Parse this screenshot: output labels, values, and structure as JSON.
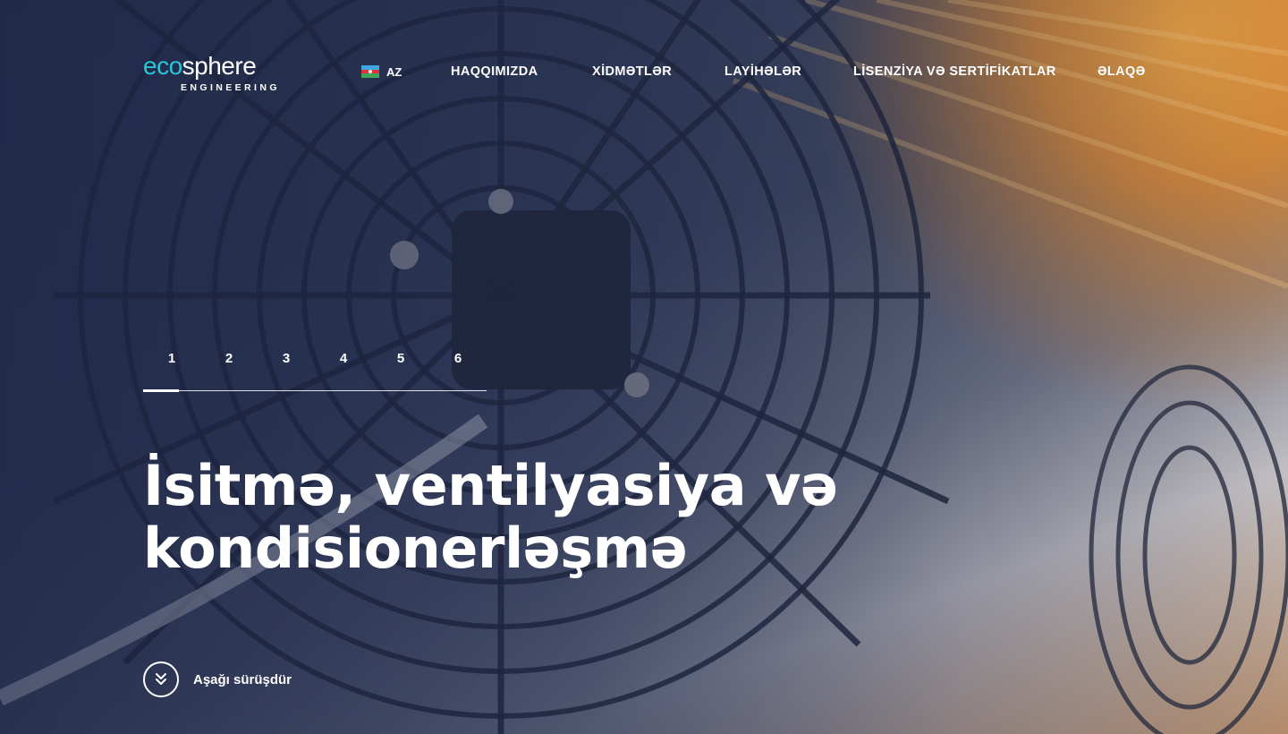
{
  "brand": {
    "logo_eco": "eco",
    "logo_sphere": "sphere",
    "logo_sub": "ENGINEERING",
    "accent_color": "#2ac6d8"
  },
  "header": {
    "language": {
      "code": "AZ",
      "flag": "azerbaijan-flag"
    },
    "nav": [
      {
        "label": "HAQQIMIZDA"
      },
      {
        "label": "XİDMƏTLƏR"
      },
      {
        "label": "LAYİHƏLƏR"
      },
      {
        "label": "LİSENZİYA VƏ SERTİFİKATLAR"
      },
      {
        "label": "ƏLAQƏ"
      }
    ]
  },
  "slider": {
    "pages": [
      "1",
      "2",
      "3",
      "4",
      "5",
      "6"
    ],
    "active_index": 0
  },
  "hero": {
    "headline_line1": "İsitmə, ventilyasiya və",
    "headline_line2": "kondisionerləşmə",
    "background_image": "industrial-fan-photo"
  },
  "scroll_cta": {
    "label": "Aşağı sürüşdür",
    "icon": "double-chevron-down-icon"
  }
}
